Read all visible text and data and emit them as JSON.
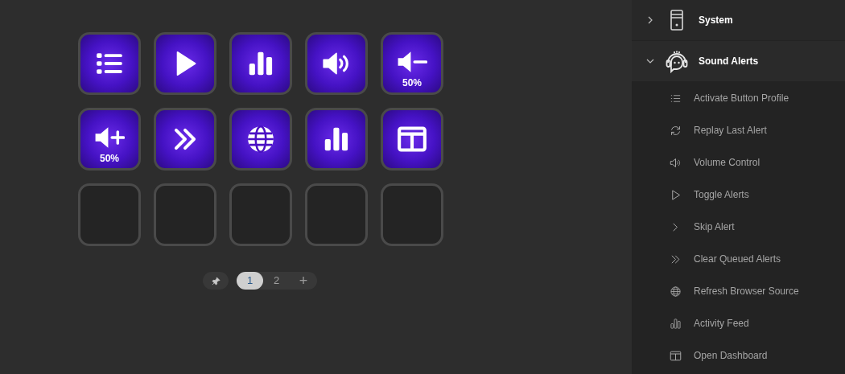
{
  "keys": [
    {
      "kind": "list"
    },
    {
      "kind": "play"
    },
    {
      "kind": "bars"
    },
    {
      "kind": "volume"
    },
    {
      "kind": "volume-down",
      "label": "50%"
    },
    {
      "kind": "volume-up",
      "label": "50%"
    },
    {
      "kind": "forward"
    },
    {
      "kind": "globe"
    },
    {
      "kind": "bars"
    },
    {
      "kind": "layout"
    },
    {
      "kind": "empty"
    },
    {
      "kind": "empty"
    },
    {
      "kind": "empty"
    },
    {
      "kind": "empty"
    },
    {
      "kind": "empty"
    }
  ],
  "pager": {
    "pages": [
      {
        "label": "1",
        "selected": true
      },
      {
        "label": "2",
        "selected": false
      }
    ],
    "add": "+"
  },
  "sidebar": [
    {
      "name": "System",
      "kind": "tower",
      "expanded": false
    },
    {
      "name": "Sound Alerts",
      "kind": "mascot",
      "expanded": true,
      "items": [
        {
          "label": "Activate Button Profile",
          "kind": "list"
        },
        {
          "label": "Replay Last Alert",
          "kind": "replay"
        },
        {
          "label": "Volume Control",
          "kind": "volume"
        },
        {
          "label": "Toggle Alerts",
          "kind": "play"
        },
        {
          "label": "Skip Alert",
          "kind": "chevron"
        },
        {
          "label": "Clear Queued Alerts",
          "kind": "forward"
        },
        {
          "label": "Refresh Browser Source",
          "kind": "globe"
        },
        {
          "label": "Activity Feed",
          "kind": "bars"
        },
        {
          "label": "Open Dashboard",
          "kind": "layout"
        }
      ]
    }
  ]
}
